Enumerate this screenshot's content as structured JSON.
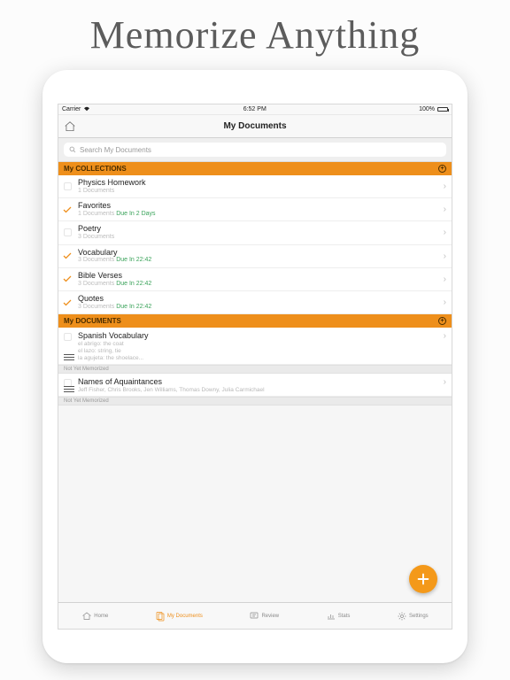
{
  "promo": {
    "title": "Memorize Anything"
  },
  "status": {
    "carrier": "Carrier",
    "wifi": "▲",
    "time": "6:52 PM",
    "battery_pct": "100%"
  },
  "nav": {
    "title": "My Documents"
  },
  "search": {
    "placeholder": "Search My Documents"
  },
  "sections": {
    "collections": {
      "label": "My COLLECTIONS"
    },
    "documents": {
      "label": "My DOCUMENTS"
    }
  },
  "collections": [
    {
      "title": "Physics Homework",
      "count": "1 Documents",
      "due": "",
      "checked": false
    },
    {
      "title": "Favorites",
      "count": "1 Documents",
      "due": "Due In 2 Days",
      "checked": true
    },
    {
      "title": "Poetry",
      "count": "3 Documents",
      "due": "",
      "checked": false
    },
    {
      "title": "Vocabulary",
      "count": "3 Documents",
      "due": "Due In 22:42",
      "checked": true
    },
    {
      "title": "Bible Verses",
      "count": "3 Documents",
      "due": "Due In 22:42",
      "checked": true
    },
    {
      "title": "Quotes",
      "count": "3 Documents",
      "due": "Due In 22:42",
      "checked": true
    }
  ],
  "documents": [
    {
      "title": "Spanish Vocabulary",
      "preview_lines": [
        "el abrigo: the coat",
        "el lazo: string, tie",
        "la agujeta: the shoelace..."
      ],
      "status": "Not Yet Memorized"
    },
    {
      "title": "Names of Aquaintances",
      "preview_lines": [
        "Jeff Fisher, Chris Brooks, Jen Williams, Thomas Downy, Julia Carmichael"
      ],
      "status": "Not Yet Memorized"
    }
  ],
  "tabs": [
    {
      "label": "Home"
    },
    {
      "label": "My Documents"
    },
    {
      "label": "Review"
    },
    {
      "label": "Stats"
    },
    {
      "label": "Settings"
    }
  ],
  "colors": {
    "accent": "#ee8f1b",
    "success": "#3aa35a"
  }
}
